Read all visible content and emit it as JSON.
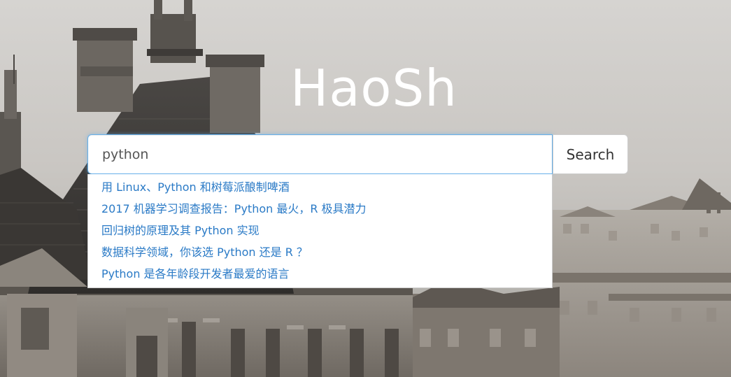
{
  "brand": {
    "title": "HaoSh"
  },
  "search": {
    "value": "python",
    "button_label": "Search"
  },
  "suggestions": [
    "用 Linux、Python 和树莓派酿制啤酒",
    "2017 机器学习调查报告：Python 最火，R 极具潜力",
    "回归树的原理及其 Python 实现",
    "数据科学领域，你该选 Python 还是 R ？",
    "Python 是各年龄段开发者最爱的语言"
  ],
  "colors": {
    "focus_border": "#66afe9",
    "suggestion_link": "#2a7ac6",
    "title_text": "#ffffff"
  }
}
